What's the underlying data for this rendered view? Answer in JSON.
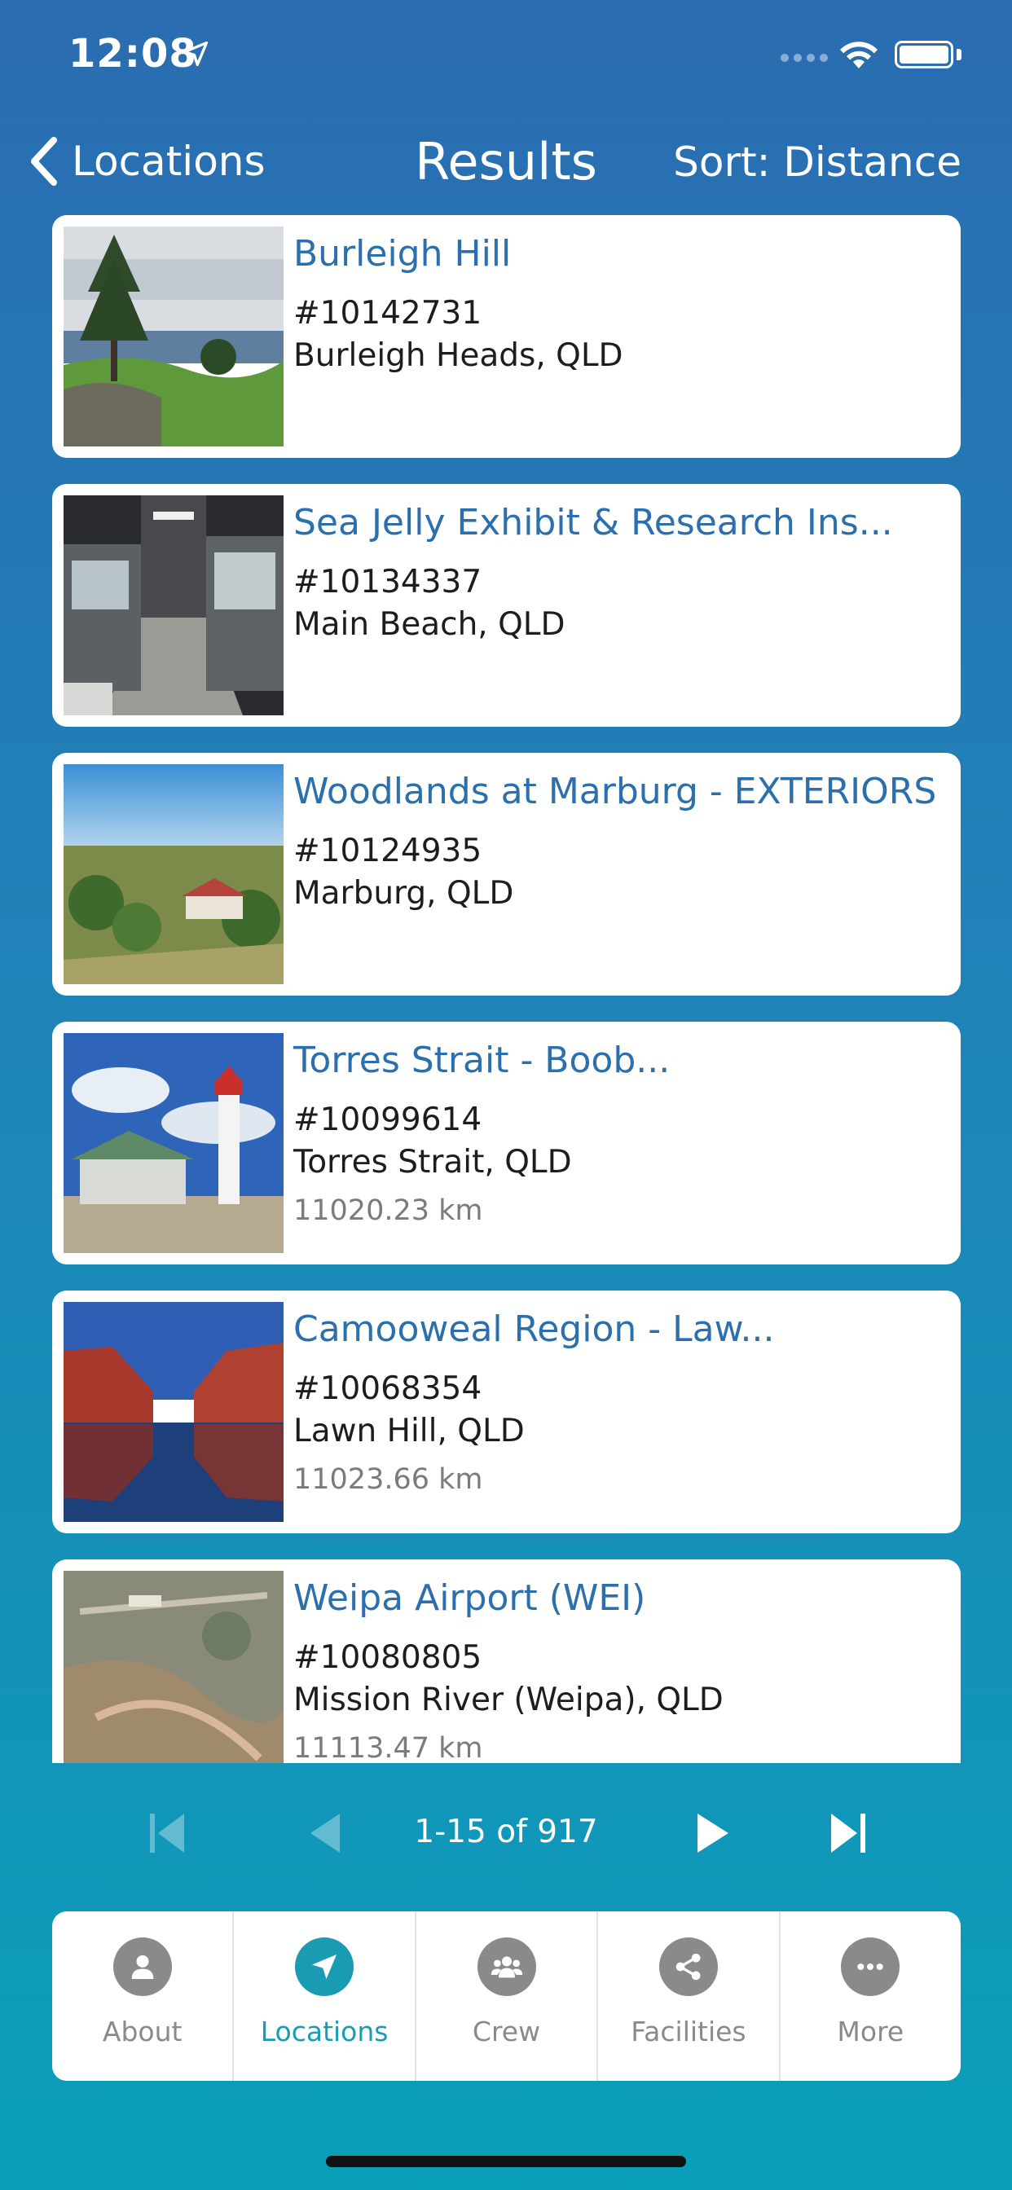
{
  "status": {
    "time": "12:08"
  },
  "nav": {
    "back_label": "Locations",
    "title": "Results",
    "sort_label": "Sort: Distance"
  },
  "results": [
    {
      "title": "Burleigh Hill",
      "id": "#10142731",
      "place": "Burleigh Heads, QLD",
      "distance": "",
      "thumb": "coast-photo"
    },
    {
      "title": "Sea Jelly Exhibit & Research Ins...",
      "id": "#10134337",
      "place": "Main Beach, QLD",
      "distance": "",
      "thumb": "lab-photo"
    },
    {
      "title": "Woodlands at Marburg - EXTERIORS",
      "id": "#10124935",
      "place": "Marburg, QLD",
      "distance": "",
      "thumb": "estate-photo"
    },
    {
      "title": "Torres Strait - Boob...",
      "id": "#10099614",
      "place": "Torres Strait, QLD",
      "distance": "11020.23 km",
      "thumb": "lighthouse-photo"
    },
    {
      "title": "Camooweal Region - Law...",
      "id": "#10068354",
      "place": "Lawn Hill, QLD",
      "distance": "11023.66 km",
      "thumb": "gorge-photo"
    },
    {
      "title": "Weipa Airport (WEI)",
      "id": "#10080805",
      "place": "Mission River (Weipa), QLD",
      "distance": "11113.47 km",
      "thumb": "aerial-photo"
    }
  ],
  "pagination": {
    "text": "1-15 of 917"
  },
  "tabs": [
    {
      "label": "About",
      "icon": "person-icon",
      "active": false
    },
    {
      "label": "Locations",
      "icon": "location-arrow-icon",
      "active": true
    },
    {
      "label": "Crew",
      "icon": "group-icon",
      "active": false
    },
    {
      "label": "Facilities",
      "icon": "share-icon",
      "active": false
    },
    {
      "label": "More",
      "icon": "more-dots-icon",
      "active": false
    }
  ],
  "colors": {
    "accent": "#1a9bb4",
    "title_blue": "#2c6fad",
    "tab_grey": "#8a8a8a"
  }
}
